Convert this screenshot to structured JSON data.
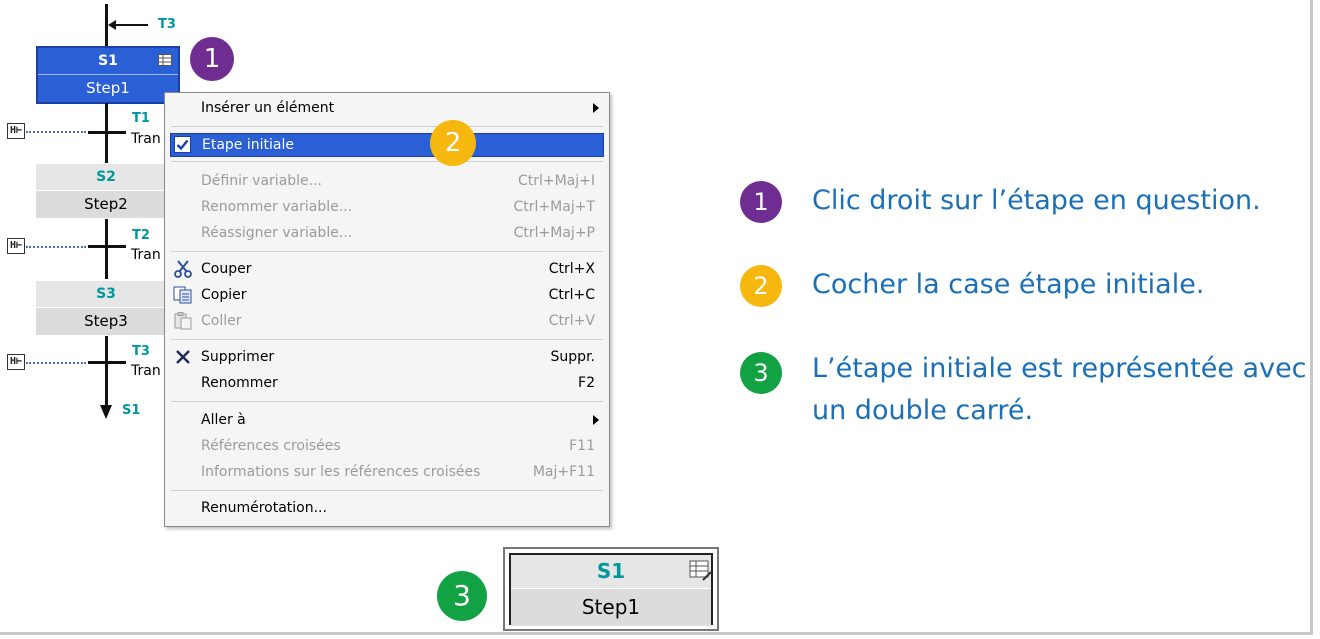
{
  "sfc": {
    "top_jump": "T3",
    "steps": [
      {
        "id": "S1",
        "name": "Step1"
      },
      {
        "id": "S2",
        "name": "Step2"
      },
      {
        "id": "S3",
        "name": "Step3"
      }
    ],
    "transitions": [
      {
        "id": "T1",
        "name": "Tran"
      },
      {
        "id": "T2",
        "name": "Tran"
      },
      {
        "id": "T3",
        "name": "Tran"
      }
    ],
    "bottom_jump": "S1",
    "interlock_label": "H⊢"
  },
  "menu": {
    "items": [
      {
        "label": "Insérer un élément",
        "shortcut": "",
        "disabled": false,
        "submenu": true
      },
      {
        "label": "Etape initiale",
        "shortcut": "",
        "disabled": false,
        "checked": true,
        "highlighted": true
      },
      {
        "label": "Définir variable...",
        "shortcut": "Ctrl+Maj+I",
        "disabled": true
      },
      {
        "label": "Renommer variable...",
        "shortcut": "Ctrl+Maj+T",
        "disabled": true
      },
      {
        "label": "Réassigner variable...",
        "shortcut": "Ctrl+Maj+P",
        "disabled": true
      },
      {
        "label": "Couper",
        "shortcut": "Ctrl+X",
        "disabled": false,
        "icon": "scissors-icon"
      },
      {
        "label": "Copier",
        "shortcut": "Ctrl+C",
        "disabled": false,
        "icon": "copy-icon"
      },
      {
        "label": "Coller",
        "shortcut": "Ctrl+V",
        "disabled": true,
        "icon": "paste-icon"
      },
      {
        "label": "Supprimer",
        "shortcut": "Suppr.",
        "disabled": false,
        "icon": "delete-x-icon"
      },
      {
        "label": "Renommer",
        "shortcut": "F2",
        "disabled": false
      },
      {
        "label": "Aller à",
        "shortcut": "",
        "disabled": false,
        "submenu": true
      },
      {
        "label": "Références croisées",
        "shortcut": "F11",
        "disabled": true
      },
      {
        "label": "Informations sur les références croisées",
        "shortcut": "Maj+F11",
        "disabled": true
      },
      {
        "label": "Renumérotation...",
        "shortcut": "",
        "disabled": false
      }
    ]
  },
  "badges": {
    "one": "1",
    "two": "2",
    "three": "3"
  },
  "colors": {
    "purple": "#6f2c91",
    "yellow": "#f6b70f",
    "green": "#13a243",
    "note_blue": "#1a70b8",
    "highlight": "#2b5fd6"
  },
  "notes": [
    {
      "badge": "1",
      "text": "Clic droit sur l’étape en question."
    },
    {
      "badge": "2",
      "text": "Cocher la case étape initiale."
    },
    {
      "badge": "3",
      "line1": "L’étape initiale est représentée avec",
      "line2": "un double carré."
    }
  ],
  "initial_step": {
    "id": "S1",
    "name": "Step1"
  }
}
